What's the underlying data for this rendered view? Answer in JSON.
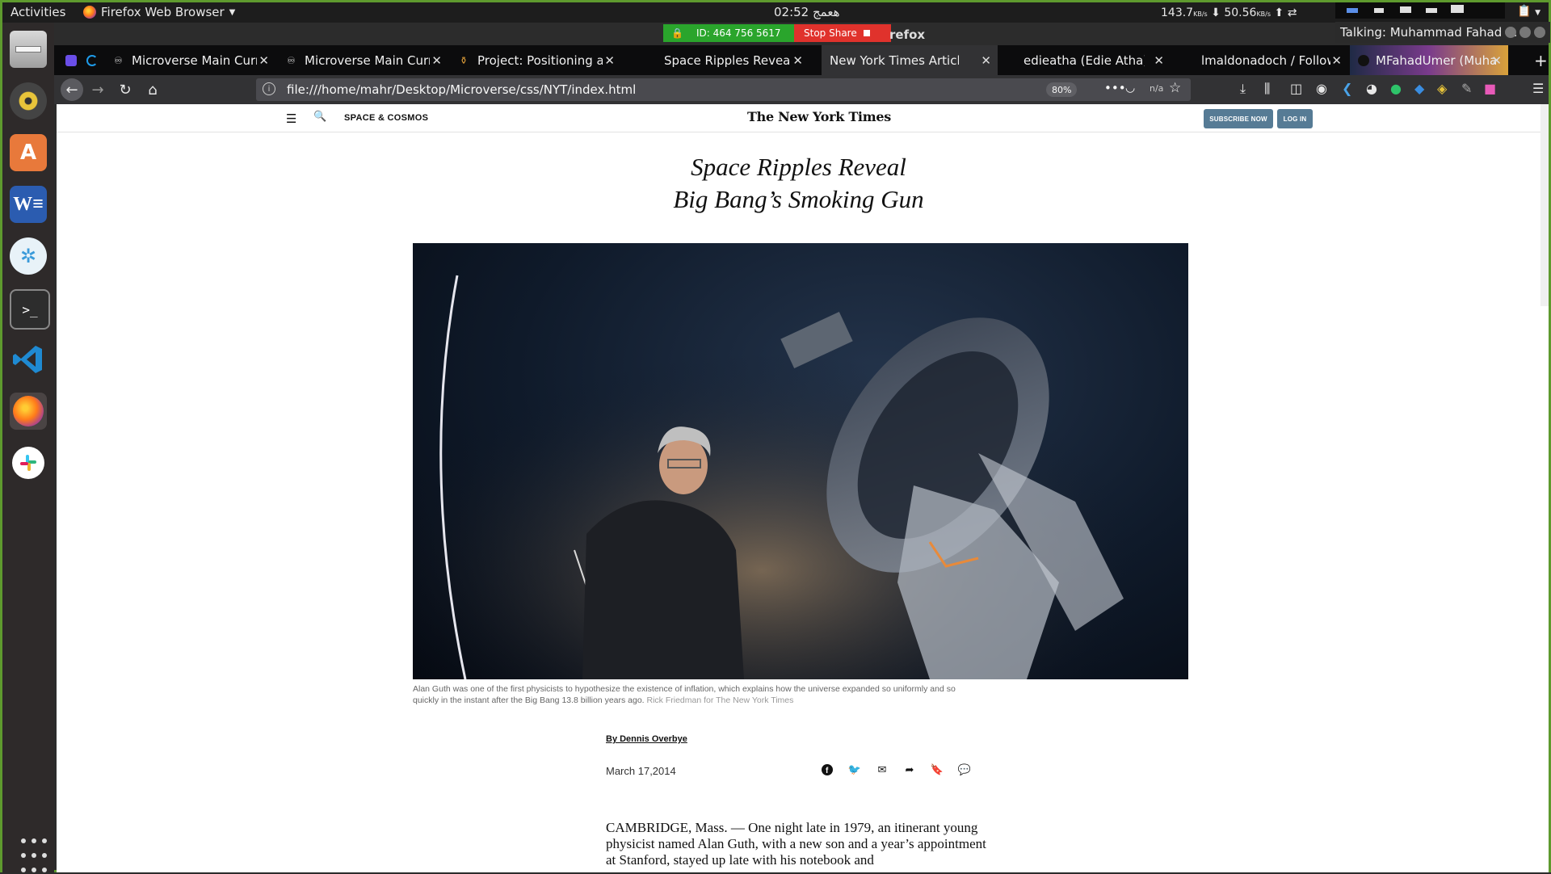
{
  "topbar": {
    "activities": "Activities",
    "app_name": "Firefox Web Browser",
    "clock": "02:52 هعمج",
    "net_up": "143.7",
    "net_up_unit": "KB/s",
    "net_down": "50.56",
    "net_down_unit": "KB/s"
  },
  "zoom": {
    "meeting_id": "ID: 464 756 5617",
    "stop_share": "Stop Share",
    "window_title": "refox",
    "talking": "Talking: Muhammad Fahad ..."
  },
  "tabs": [
    {
      "label": "",
      "icon": "microverse-icon",
      "active": false
    },
    {
      "label": "",
      "icon": "loading-icon",
      "active": false
    },
    {
      "label": "Microverse Main Curricu",
      "icon": "microverse-icon",
      "active": false
    },
    {
      "label": "Microverse Main Curricu",
      "icon": "microverse-icon",
      "active": false
    },
    {
      "label": "Project: Positioning and",
      "icon": "project-icon",
      "active": false
    },
    {
      "label": "Space Ripples Reveal Bi",
      "icon": "",
      "active": false
    },
    {
      "label": "New York Times Article",
      "icon": "",
      "active": true
    },
    {
      "label": "edieatha (Edie Atha)",
      "icon": "",
      "active": false
    },
    {
      "label": "lmaldonadoch / Followe",
      "icon": "",
      "active": false
    },
    {
      "label": "MFahadUmer (Muham",
      "icon": "github-icon",
      "active": false
    }
  ],
  "navbar": {
    "url": "file:///home/mahr/Desktop/Microverse/css/NYT/index.html",
    "zoom_level": "80%",
    "na": "n/a"
  },
  "page": {
    "section": "SPACE & COSMOS",
    "masthead": "The New York Times",
    "subscribe": "SUBSCRIBE NOW",
    "login": "LOG IN",
    "headline_line1": "Space Ripples Reveal",
    "headline_line2": "Big Bang’s Smoking Gun",
    "caption": "Alan Guth was one of the first physicists to hypothesize the existence of inflation, which explains how the universe expanded so uniformly and so quickly in the instant after the Big Bang 13.8 billion years ago.",
    "credit": "Rick Friedman for The New York Times",
    "byline": "By Dennis Overbye",
    "date": "March 17,2014",
    "body": "CAMBRIDGE, Mass. — One night late in 1979, an itinerant young physicist named Alan Guth, with a new son and a year’s appointment at Stanford, stayed up late with his notebook and"
  },
  "colors": {
    "accent_green": "#2aa52c",
    "stop_red": "#e0322c",
    "nyt_button": "#567b95",
    "tab_active": "#323234"
  }
}
